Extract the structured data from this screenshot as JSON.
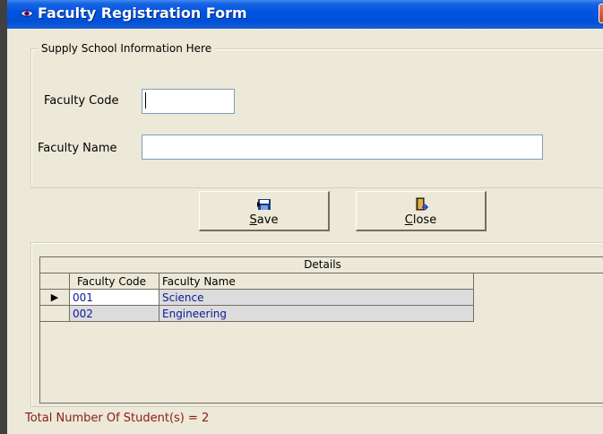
{
  "window": {
    "title": "Faculty Registration Form",
    "close_glyph": "X",
    "title_icon": "eye-icon"
  },
  "school_group": {
    "legend": "Supply School Information Here",
    "faculty_code_label": "Faculty Code",
    "faculty_code_value": "",
    "faculty_name_label": "Faculty Name",
    "faculty_name_value": ""
  },
  "buttons": {
    "save": {
      "prefix": "",
      "accel": "S",
      "rest": "ave",
      "icon": "save-icon"
    },
    "close": {
      "prefix": "",
      "accel": "C",
      "rest": "lose",
      "icon": "door-exit-icon"
    }
  },
  "grid": {
    "caption": "Details",
    "columns": [
      "Faculty Code",
      "Faculty Name"
    ],
    "rows": [
      {
        "code": "001",
        "name": "Science"
      },
      {
        "code": "002",
        "name": "Engineering"
      }
    ],
    "selected_row_marker": "▶"
  },
  "status": {
    "text": "Total Number Of Student(s) = 2"
  },
  "colors": {
    "titlebar": "#0054e3",
    "status_text": "#8b1a1a",
    "cell_text": "#0a1a9a"
  }
}
